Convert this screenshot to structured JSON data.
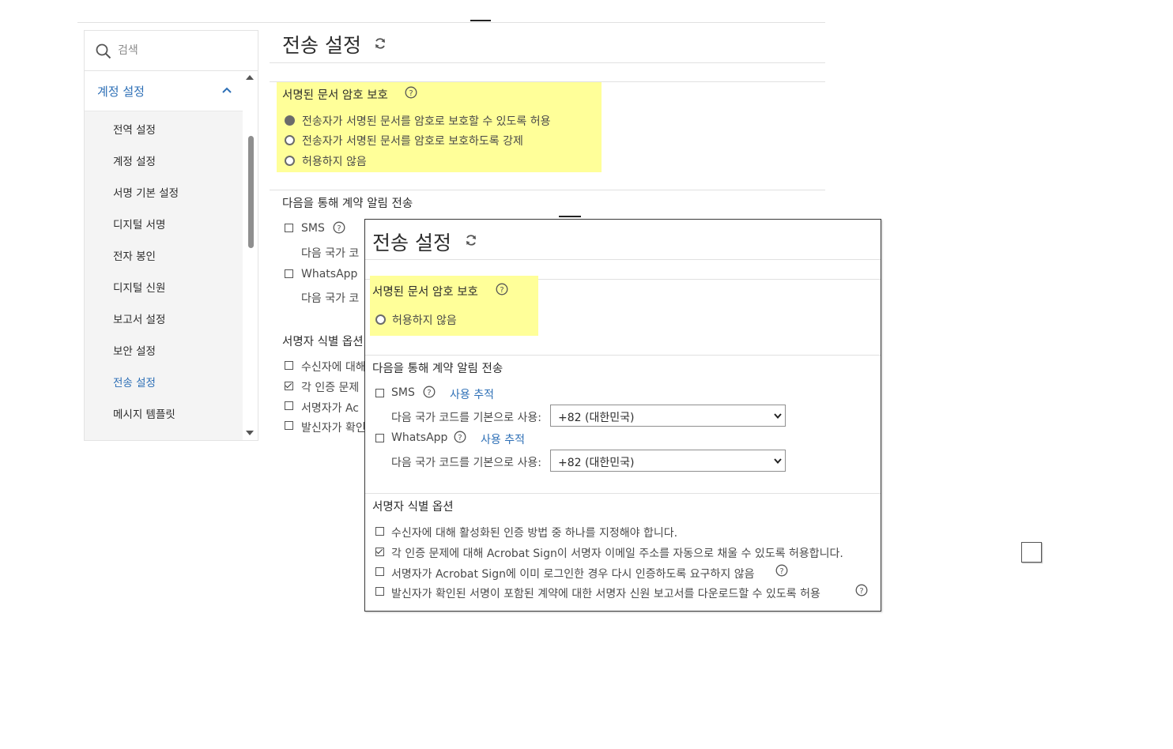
{
  "sidebar": {
    "search_placeholder": "검색",
    "section_label": "계정 설정",
    "items": [
      {
        "label": "전역 설정"
      },
      {
        "label": "계정 설정"
      },
      {
        "label": "서명 기본 설정"
      },
      {
        "label": "디지털 서명"
      },
      {
        "label": "전자 봉인"
      },
      {
        "label": "디지털 신원"
      },
      {
        "label": "보고서 설정"
      },
      {
        "label": "보안 설정"
      },
      {
        "label": "전송 설정"
      },
      {
        "label": "메시지 템플릿"
      }
    ]
  },
  "main": {
    "title": "전송 설정",
    "pw_protect": {
      "title": "서명된 문서 암호 보호",
      "options": [
        "전송자가 서명된 문서를 암호로 보호할 수 있도록 허용",
        "전송자가 서명된 문서를 암호로 보호하도록 강제",
        "허용하지 않음"
      ]
    },
    "notify": {
      "title": "다음을 통해 계약 알림 전송",
      "sms": "SMS",
      "country_prefix": "다음 국가 코",
      "whatsapp": "WhatsApp"
    },
    "signer_id": {
      "title_partial": "서명자 식별 옵션",
      "items_partial": [
        "수신자에 대해",
        "각 인증 문제",
        "서명자가 Ac",
        "발신자가 확인"
      ]
    }
  },
  "popup": {
    "title": "전송 설정",
    "pw_protect": {
      "title": "서명된 문서 암호 보호",
      "option": "허용하지 않음"
    },
    "notify": {
      "title": "다음을 통해 계약 알림 전송",
      "sms_label": "SMS",
      "whatsapp_label": "WhatsApp",
      "usage_link": "사용 추적",
      "country_label": "다음 국가 코드를 기본으로 사용:",
      "country_value": "+82 (대한민국)"
    },
    "signer_id": {
      "title": "서명자 식별 옵션",
      "items": [
        "수신자에 대해 활성화된 인증 방법 중 하나를 지정해야 합니다.",
        "각 인증 문제에 대해 Acrobat Sign이 서명자 이메일 주소를 자동으로 채울 수 있도록 허용합니다.",
        "서명자가 Acrobat Sign에 이미 로그인한 경우 다시 인증하도록 요구하지 않음",
        "발신자가 확인된 서명이 포함된 계약에 대한 서명자 신원 보고서를 다운로드할 수 있도록 허용"
      ]
    }
  },
  "colors": {
    "accent": "#2d6fb6",
    "highlight": "#ffff99"
  }
}
